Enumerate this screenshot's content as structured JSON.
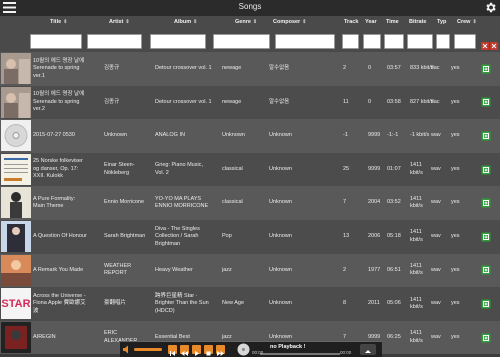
{
  "window": {
    "title": "Songs"
  },
  "columns": [
    {
      "key": "title",
      "label": "Title"
    },
    {
      "key": "artist",
      "label": "Artist"
    },
    {
      "key": "album",
      "label": "Album"
    },
    {
      "key": "genre",
      "label": "Genre"
    },
    {
      "key": "composer",
      "label": "Composer"
    },
    {
      "key": "track",
      "label": "Track"
    },
    {
      "key": "year",
      "label": "Year"
    },
    {
      "key": "time",
      "label": "Time"
    },
    {
      "key": "bitrate",
      "label": "Bitrate"
    },
    {
      "key": "type",
      "label": "Typ"
    },
    {
      "key": "crew",
      "label": "Crew"
    }
  ],
  "sort_glyph": "⇕",
  "rows": [
    {
      "title": "10월의 에드 명장 날에 Serenade to spring ver.1",
      "artist": "김종규",
      "album": "Detour crossover vol. 1",
      "genre": "newage",
      "composer": "알수없음",
      "track": "2",
      "year": "0",
      "time": "03:57",
      "bitrate": "833 kbit/s",
      "type": "flac",
      "crew": "yes",
      "thumb": "photo"
    },
    {
      "title": "10월의 에드 명장 날에 Serenade to spring ver.2",
      "artist": "김종규",
      "album": "Detour crossover vol. 1",
      "genre": "newage",
      "composer": "알수없음",
      "track": "11",
      "year": "0",
      "time": "03:58",
      "bitrate": "827 kbit/s",
      "type": "flac",
      "crew": "yes",
      "thumb": "photo"
    },
    {
      "title": "2015-07-27 0530",
      "artist": "Unknown",
      "album": "ANALOG IN",
      "genre": "Unknown",
      "composer": "Unknown",
      "track": "-1",
      "year": "9999",
      "time": "-1:-1",
      "bitrate": "-1 kbit/s",
      "type": "wav",
      "crew": "yes",
      "thumb": "disc"
    },
    {
      "title": "25 Norske folkeviser og danser, Op. 17: XXII. Kulokk",
      "artist": "Einar Steen-Nökleberg",
      "album": "Grieg: Piano Music, Vol. 2",
      "genre": "classical",
      "composer": "Unknown",
      "track": "25",
      "year": "9999",
      "time": "01:07",
      "bitrate": "1411 kbit/s",
      "type": "wav",
      "crew": "yes",
      "thumb": "score"
    },
    {
      "title": "A Pure Formality: Main Theme",
      "artist": "Ennio Morricone",
      "album": "YO-YO MA PLAYS ENNIO MORRICONE",
      "genre": "classical",
      "composer": "Unknown",
      "track": "7",
      "year": "2004",
      "time": "03:52",
      "bitrate": "1411 kbit/s",
      "type": "wav",
      "crew": "yes",
      "thumb": "cello"
    },
    {
      "title": "A Question Of Honour",
      "artist": "Sarah Brightman",
      "album": "Diva - The Singles Collection / Sarah Brightman",
      "genre": "Pop",
      "composer": "Unknown",
      "track": "13",
      "year": "2006",
      "time": "05:18",
      "bitrate": "1411 kbit/s",
      "type": "wav",
      "crew": "yes",
      "thumb": "diva"
    },
    {
      "title": "A Remark You Made",
      "artist": "WEATHER REPORT",
      "album": "Heavy Weather",
      "genre": "jazz",
      "composer": "Unknown",
      "track": "2",
      "year": "1977",
      "time": "06:51",
      "bitrate": "1411 kbit/s",
      "type": "wav",
      "crew": "yes",
      "thumb": "weather"
    },
    {
      "title": "Across the Universe -Fiona Apple 費歐娜艾波",
      "artist": "豪翻唱片",
      "album": "跨界巨星精 Star · Brighter Than the Sun (HDCD)",
      "genre": "New Age",
      "composer": "Unknown",
      "track": "8",
      "year": "2011",
      "time": "05:06",
      "bitrate": "1411 kbit/s",
      "type": "wav",
      "crew": "yes",
      "thumb": "star"
    },
    {
      "title": "AIREGIN",
      "artist": "ERIC ALEXANDER",
      "album": "Essential Best",
      "genre": "jazz",
      "composer": "Unknown",
      "track": "7",
      "year": "9999",
      "time": "06:25",
      "bitrate": "1411 kbit/s",
      "type": "wav",
      "crew": "yes",
      "thumb": "eric"
    }
  ],
  "player": {
    "label": "no Playback !",
    "time_left": "00:00",
    "time_right": "00:00"
  },
  "colors": {
    "accent": "#e98a2a",
    "add_icon": "#2e9e3a",
    "clear_icon": "#c0392b"
  }
}
